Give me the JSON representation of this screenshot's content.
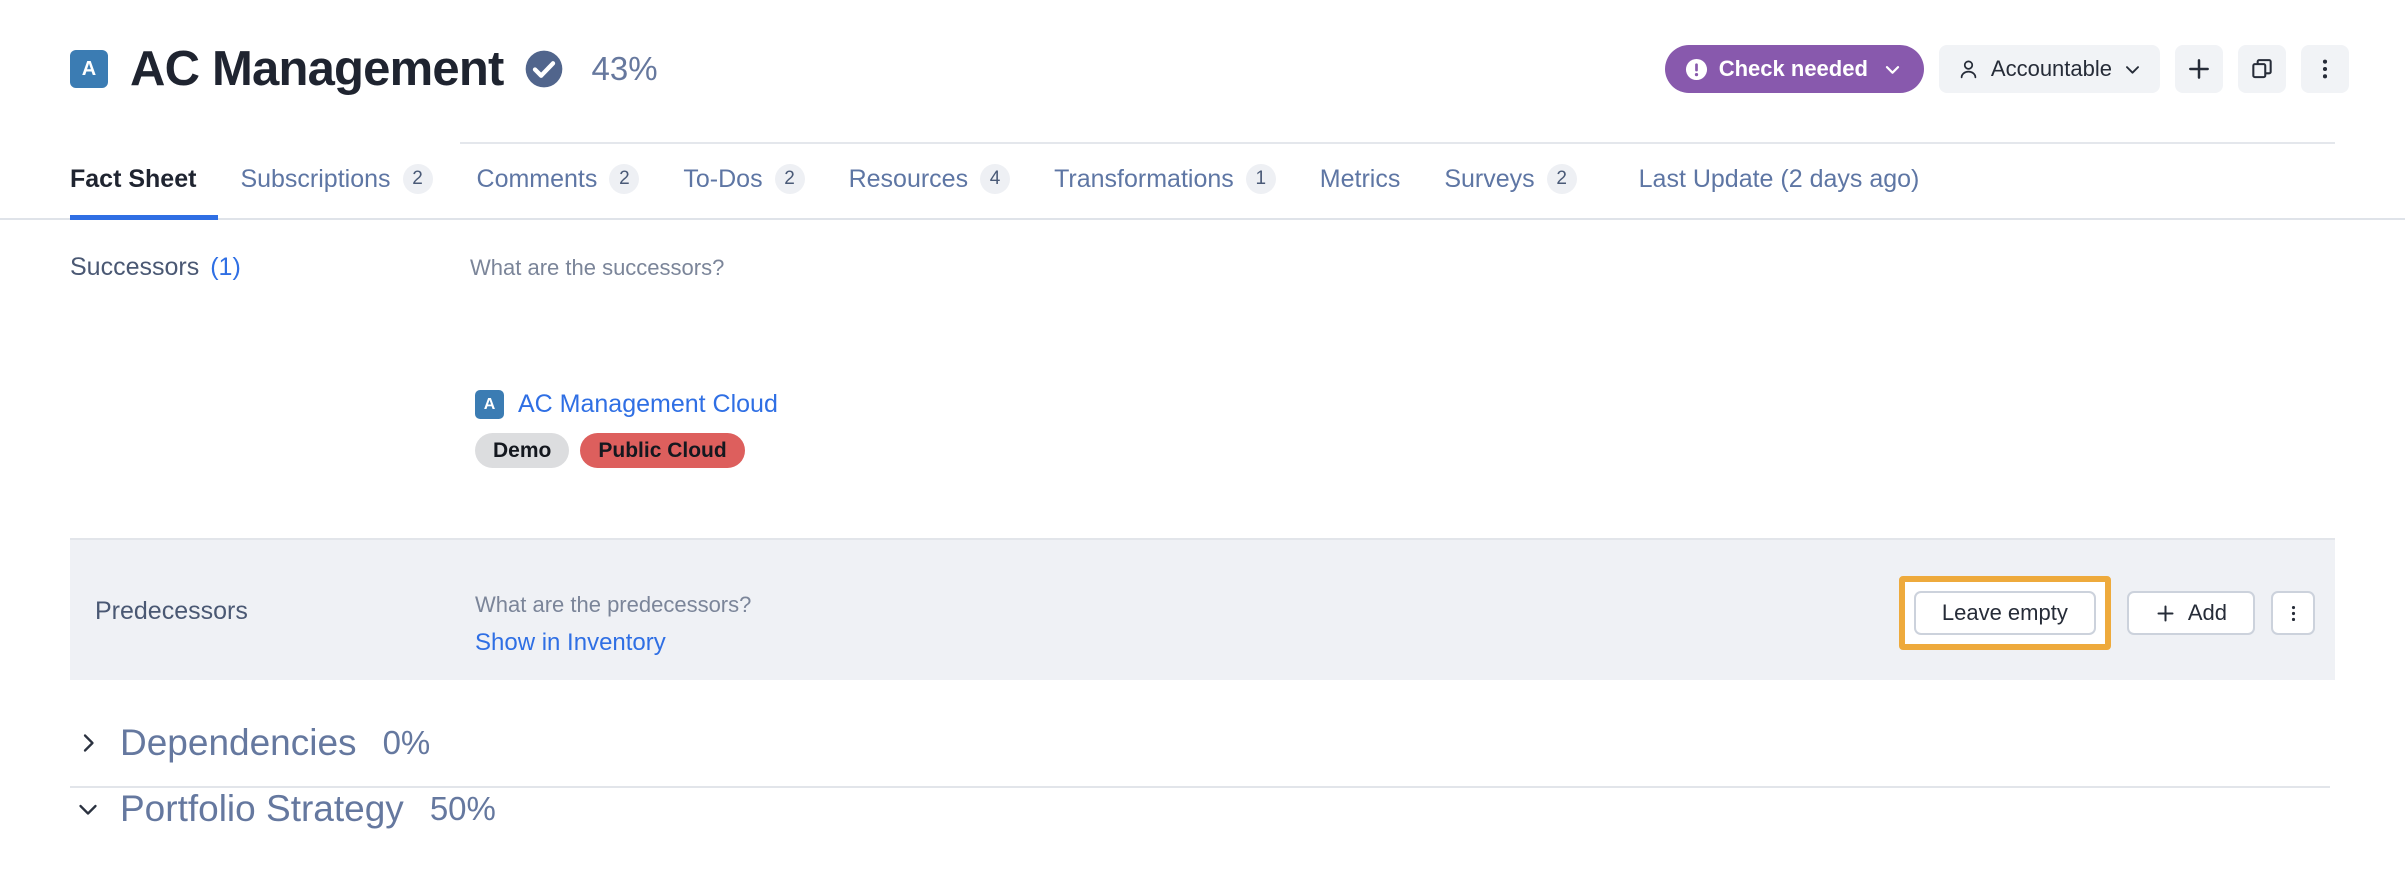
{
  "header": {
    "type_badge": "A",
    "title": "AC Management",
    "verified_icon": "verified-check-icon",
    "completion": "43%",
    "status": {
      "icon": "exclamation-circle-icon",
      "label": "Check needed",
      "caret": "chevron-down-icon",
      "color": "#8859ad"
    },
    "responsible": {
      "icon": "user-icon",
      "label": "Accountable",
      "caret": "chevron-down-icon"
    },
    "add_button": "plus-icon",
    "copy_button": "copy-icon",
    "more_button": "kebab-menu-icon"
  },
  "tabs": [
    {
      "label": "Fact Sheet",
      "count": "",
      "active": true
    },
    {
      "label": "Subscriptions",
      "count": "2",
      "active": false
    },
    {
      "label": "Comments",
      "count": "2",
      "active": false
    },
    {
      "label": "To-Dos",
      "count": "2",
      "active": false
    },
    {
      "label": "Resources",
      "count": "4",
      "active": false
    },
    {
      "label": "Transformations",
      "count": "1",
      "active": false
    },
    {
      "label": "Metrics",
      "count": "",
      "active": false
    },
    {
      "label": "Surveys",
      "count": "2",
      "active": false
    },
    {
      "label": "Last Update (2 days ago)",
      "count": "",
      "active": false
    }
  ],
  "successors": {
    "label": "Successors",
    "count": "(1)",
    "hint": "What are the successors?",
    "item": {
      "badge": "A",
      "name": "AC Management Cloud",
      "tags": [
        {
          "label": "Demo",
          "color": "#dcdddf"
        },
        {
          "label": "Public Cloud",
          "color": "#dd5f5d"
        }
      ]
    }
  },
  "predecessors": {
    "label": "Predecessors",
    "hint": "What are the predecessors?",
    "link": "Show in Inventory",
    "leave_empty_label": "Leave empty",
    "add_label": "Add",
    "add_icon": "plus-icon",
    "more_icon": "kebab-menu-icon",
    "highlight_color": "#eeaa3c"
  },
  "sections": [
    {
      "title": "Dependencies",
      "pct": "0%",
      "expanded": false,
      "chevron": "chevron-right-icon"
    },
    {
      "title": "Portfolio Strategy",
      "pct": "50%",
      "expanded": true,
      "chevron": "chevron-down-icon"
    }
  ]
}
